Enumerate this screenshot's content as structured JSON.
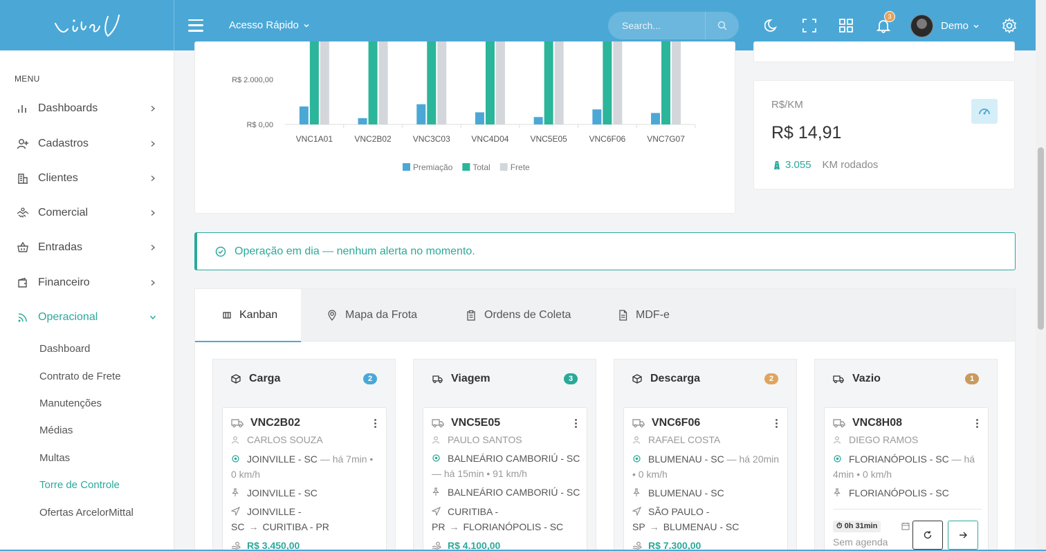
{
  "topbar": {
    "brand": "Vinci",
    "quick_access": "Acesso Rápido",
    "search_placeholder": "Search...",
    "notification_count": "3",
    "user_name": "Demo"
  },
  "sidebar": {
    "menu_title": "MENU",
    "items": [
      {
        "label": "Dashboards",
        "icon": "bar-chart-icon"
      },
      {
        "label": "Cadastros",
        "icon": "user-plus-icon"
      },
      {
        "label": "Clientes",
        "icon": "building-icon"
      },
      {
        "label": "Comercial",
        "icon": "handshake-icon"
      },
      {
        "label": "Entradas",
        "icon": "basket-icon"
      },
      {
        "label": "Financeiro",
        "icon": "wallet-icon"
      },
      {
        "label": "Operacional",
        "icon": "rss-icon"
      }
    ],
    "subitems": [
      "Dashboard",
      "Contrato de Frete",
      "Manutenções",
      "Médias",
      "Multas",
      "Torre de Controle",
      "Ofertas ArcelorMittal"
    ]
  },
  "chart_data": {
    "type": "bar",
    "categories": [
      "VNC1A01",
      "VNC2B02",
      "VNC3C03",
      "VNC4D04",
      "VNC5E05",
      "VNC6F06",
      "VNC7G07"
    ],
    "series": [
      {
        "name": "Premiação",
        "values": [
          800,
          280,
          900,
          540,
          330,
          670,
          510
        ],
        "color": "#4ba8d6"
      },
      {
        "name": "Total",
        "values": [
          5000,
          5000,
          5000,
          5000,
          5000,
          5000,
          5000
        ],
        "color": "#2bb59a"
      },
      {
        "name": "Frete",
        "values": [
          5000,
          5000,
          5000,
          5000,
          5000,
          5000,
          5000
        ],
        "color": "#d3d6da"
      }
    ],
    "ytick_labels": [
      "R$ 2.000,00",
      "R$ 0,00"
    ],
    "ylim": [
      0,
      3000
    ],
    "legend_position": "bottom-center"
  },
  "kpi": {
    "label": "R$/KM",
    "value": "R$ 14,91",
    "km": "3.055",
    "km_label": "KM rodados"
  },
  "alert": {
    "text": "Operação em dia — nenhum alerta no momento."
  },
  "tabs": [
    {
      "label": "Kanban",
      "icon": "columns-icon"
    },
    {
      "label": "Mapa da Frota",
      "icon": "map-pin-icon"
    },
    {
      "label": "Ordens de Coleta",
      "icon": "clipboard-icon"
    },
    {
      "label": "MDF-e",
      "icon": "file-icon"
    }
  ],
  "kanban": [
    {
      "title": "Carga",
      "count": "2",
      "badge_color": "#4ba8d6",
      "icon": "box-icon",
      "card": {
        "plate": "VNC2B02",
        "driver": "CARLOS SOUZA",
        "location": "JOINVILLE - SC",
        "location_meta": "— há 7min • 0 km/h",
        "pin": "JOINVILLE - SC",
        "route_from": "JOINVILLE - SC",
        "route_to": "CURITIBA - PR",
        "value": "R$ 3.450,00"
      }
    },
    {
      "title": "Viagem",
      "count": "3",
      "badge_color": "#2ba99a",
      "icon": "truck-fast-icon",
      "card": {
        "plate": "VNC5E05",
        "driver": "PAULO SANTOS",
        "location": "BALNEÁRIO CAMBORIÚ - SC",
        "location_meta": "— há 15min • 91 km/h",
        "pin": "BALNEÁRIO CAMBORIÚ - SC",
        "route_from": "CURITIBA - PR",
        "route_to": "FLORIANÓPOLIS - SC",
        "value": "R$ 4.100,00"
      }
    },
    {
      "title": "Descarga",
      "count": "2",
      "badge_color": "#e0a45e",
      "icon": "box-open-icon",
      "card": {
        "plate": "VNC6F06",
        "driver": "RAFAEL COSTA",
        "location": "BLUMENAU - SC",
        "location_meta": "— há 20min • 0 km/h",
        "pin": "BLUMENAU - SC",
        "route_from": "SÃO PAULO - SP",
        "route_to": "BLUMENAU - SC",
        "value": "R$ 7.300,00"
      }
    },
    {
      "title": "Vazio",
      "count": "1",
      "badge_color": "#c99a5e",
      "icon": "truck-icon",
      "card": {
        "plate": "VNC8H08",
        "driver": "DIEGO RAMOS",
        "location": "FLORIANÓPOLIS - SC",
        "location_meta": "— há 4min • 0 km/h",
        "pin": "FLORIANÓPOLIS - SC",
        "timer": "0h 31min",
        "schedule": "Sem agenda"
      }
    }
  ]
}
